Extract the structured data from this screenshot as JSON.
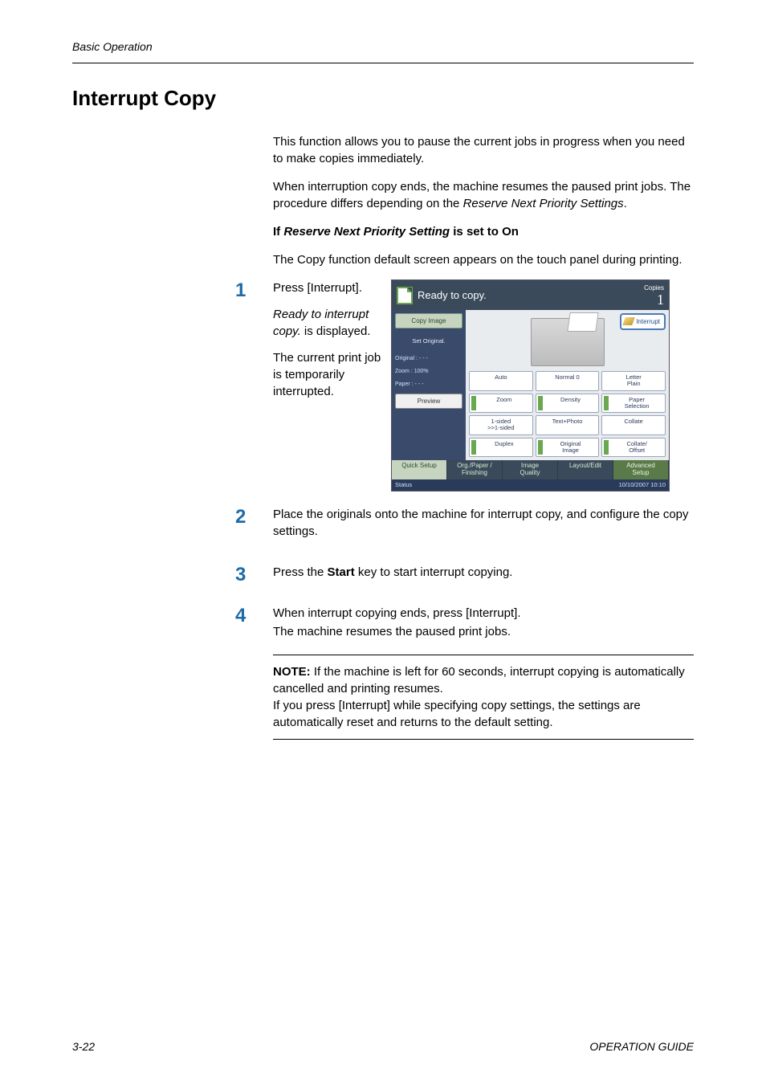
{
  "header": {
    "label": "Basic Operation"
  },
  "title": "Interrupt Copy",
  "intro": {
    "p1": "This function allows you to pause the current jobs in progress when you need to make copies immediately.",
    "p2a": "When interruption copy ends, the machine resumes the paused print jobs.",
    "p2b": "The procedure differs depending on the ",
    "p2c": "Reserve Next Priority Settings",
    "p2d": "."
  },
  "subhead": {
    "prefix": "If ",
    "ital": "Reserve Next Priority Setting",
    "suffix": " is set to On"
  },
  "lead": "The Copy function default screen appears on the touch panel during printing.",
  "steps": {
    "s1": {
      "num": "1",
      "line1": "Press [Interrupt].",
      "line2a": "Ready to interrupt copy.",
      "line2b": " is displayed.",
      "line3": "The current print job is temporarily interrupted."
    },
    "s2": {
      "num": "2",
      "text": "Place the originals onto the machine for interrupt copy, and configure the copy settings."
    },
    "s3": {
      "num": "3",
      "prefix": "Press the ",
      "bold": "Start",
      "suffix": " key to start interrupt copying."
    },
    "s4": {
      "num": "4",
      "l1": "When interrupt copying ends, press [Interrupt].",
      "l2": "The machine resumes the paused print jobs."
    }
  },
  "note": {
    "label": "NOTE:",
    "l1": " If the machine is left for 60 seconds, interrupt copying is automatically cancelled and printing resumes.",
    "l2": "If you press [Interrupt] while specifying copy settings, the settings are automatically reset and returns to the default setting."
  },
  "footer": {
    "left": "3-22",
    "right": "OPERATION GUIDE"
  },
  "panel": {
    "title": "Ready to copy.",
    "copies_label": "Copies",
    "copies_value": "1",
    "left": {
      "copy_image": "Copy Image",
      "set_original": "Set Original.",
      "meta_original": "Original   :  - - -",
      "meta_zoom": "Zoom      : 100%",
      "meta_paper": "Paper      :  - - -",
      "preview": "Preview"
    },
    "interrupt": "Interrupt",
    "grid": {
      "r1c1": "Auto",
      "r1c2": "Normal 0",
      "r1c3": "Letter\nPlain",
      "r2c1": "Zoom",
      "r2c2": "Density",
      "r2c3": "Paper\nSelection",
      "r3c1": "1-sided\n>>1-sided",
      "r3c2": "Text+Photo",
      "r3c3": "Collate",
      "r4c1": "Duplex",
      "r4c2": "Original\nImage",
      "r4c3": "Collate/\nOffset"
    },
    "tabs": {
      "t1": "Quick Setup",
      "t2": "Org./Paper /\nFinishing",
      "t3": "Image\nQuality",
      "t4": "Layout/Edit",
      "t5": "Advanced\nSetup"
    },
    "status_left": "Status",
    "status_right": "10/10/2007   10:10"
  }
}
